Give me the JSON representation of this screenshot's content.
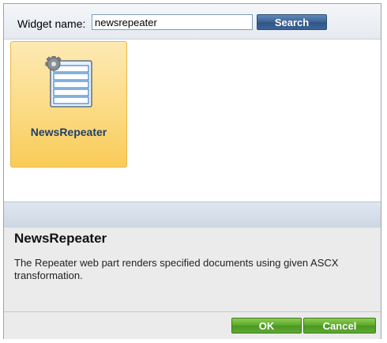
{
  "search": {
    "label": "Widget name:",
    "value": "newsrepeater",
    "button_label": "Search"
  },
  "widgets": [
    {
      "name": "NewsRepeater",
      "icon": "repeater-gear-list-icon",
      "selected": true
    }
  ],
  "info": {
    "title": "NewsRepeater",
    "description": "The Repeater web part renders specified documents using given ASCX transformation."
  },
  "footer": {
    "ok_label": "OK",
    "cancel_label": "Cancel"
  },
  "colors": {
    "selection": "#fbd97f",
    "search_button": "#3d6394",
    "action_button": "#5aa72a"
  }
}
